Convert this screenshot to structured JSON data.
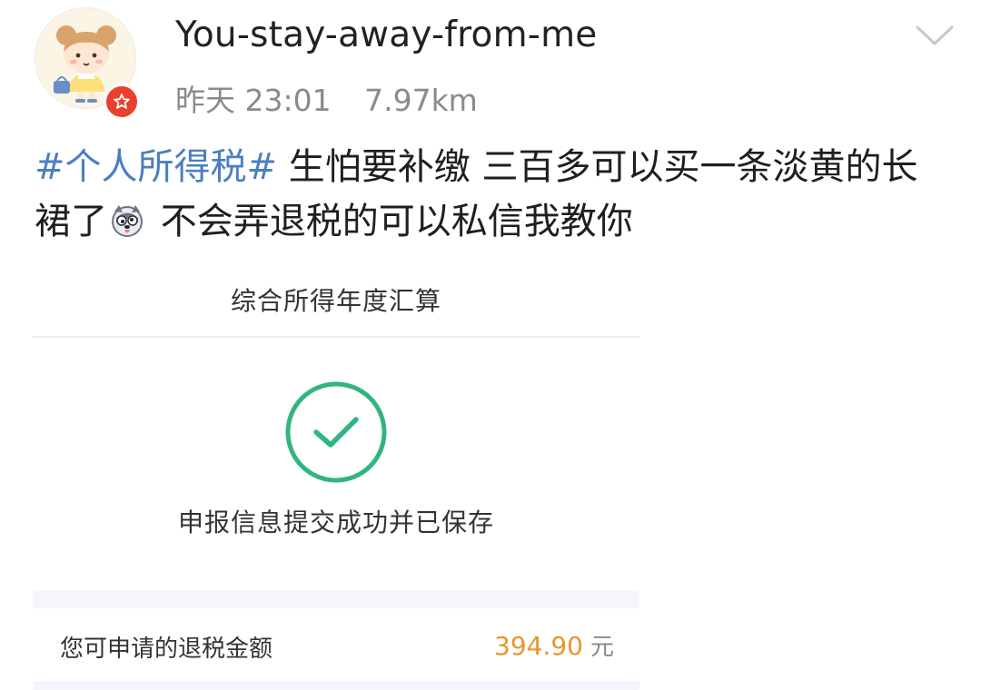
{
  "user": {
    "name": "You-stay-away-from-me",
    "time": "昨天 23:01",
    "distance": "7.97km"
  },
  "post": {
    "hashtag": "#个人所得税#",
    "text_1": " 生怕要补缴 三百多可以买一条淡黄的长裙了",
    "text_2": " 不会弄退税的可以私信我教你"
  },
  "tax_screenshot": {
    "title": "综合所得年度汇算",
    "success_message": "申报信息提交成功并已保存",
    "refund_label": "您可申请的退税金额",
    "refund_amount": "394.90",
    "refund_unit": "元"
  },
  "colors": {
    "hashtag": "#4a7fc1",
    "success_green": "#2eb67d",
    "amount_orange": "#e8962e",
    "badge_red": "#e8412f"
  },
  "icons": {
    "badge": "star-icon",
    "menu": "chevron-down-icon",
    "emoji": "dog-face-icon",
    "status": "check-circle-icon"
  }
}
